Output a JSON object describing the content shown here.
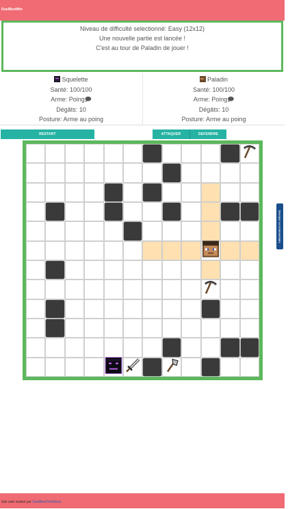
{
  "header": {
    "brand": "DuelBestWin"
  },
  "messages": [
    "Niveau de difficulté selectionné: Easy (12x12)",
    "Une nouvelle partie est lancée !",
    "C'est au tour de Paladin de jouer !"
  ],
  "players": [
    {
      "name": "Squelette",
      "health": "Santé: 100/100",
      "weapon": "Arme: Poing🗩",
      "damage": "Dégâts: 10",
      "posture": "Posture: Arme au poing"
    },
    {
      "name": "Paladin",
      "health": "Santé: 100/100",
      "weapon": "Arme: Poing🗩",
      "damage": "Dégâts: 10",
      "posture": "Posture: Arme au poing"
    }
  ],
  "buttons": {
    "restart": "RESTART",
    "attack": "ATTAQUER",
    "defend": "DEFENDRE"
  },
  "feedback": "Envoyer un commentaire",
  "footer": {
    "prefix": "Site web réalisé par ",
    "link": "DuelBestTheWorst"
  },
  "board": {
    "size": 12,
    "walls": [
      [
        0,
        6
      ],
      [
        0,
        10
      ],
      [
        1,
        7
      ],
      [
        2,
        4
      ],
      [
        2,
        6
      ],
      [
        3,
        1
      ],
      [
        3,
        4
      ],
      [
        3,
        7
      ],
      [
        3,
        10
      ],
      [
        3,
        11
      ],
      [
        4,
        5
      ],
      [
        6,
        1
      ],
      [
        8,
        1
      ],
      [
        8,
        9
      ],
      [
        9,
        1
      ],
      [
        10,
        7
      ],
      [
        10,
        10
      ],
      [
        10,
        11
      ],
      [
        11,
        6
      ],
      [
        11,
        9
      ]
    ],
    "moves": [
      [
        2,
        9
      ],
      [
        3,
        9
      ],
      [
        4,
        9
      ],
      [
        5,
        6
      ],
      [
        5,
        7
      ],
      [
        5,
        8
      ],
      [
        5,
        10
      ],
      [
        5,
        11
      ],
      [
        6,
        9
      ]
    ],
    "items": [
      {
        "row": 0,
        "col": 11,
        "type": "pickaxe-icon"
      },
      {
        "row": 7,
        "col": 9,
        "type": "pickaxe-icon"
      },
      {
        "row": 11,
        "col": 5,
        "type": "sword-icon"
      },
      {
        "row": 11,
        "col": 7,
        "type": "axe-icon"
      }
    ],
    "characters": [
      {
        "row": 5,
        "col": 9,
        "type": "paladin"
      },
      {
        "row": 11,
        "col": 4,
        "type": "skeleton"
      }
    ]
  }
}
